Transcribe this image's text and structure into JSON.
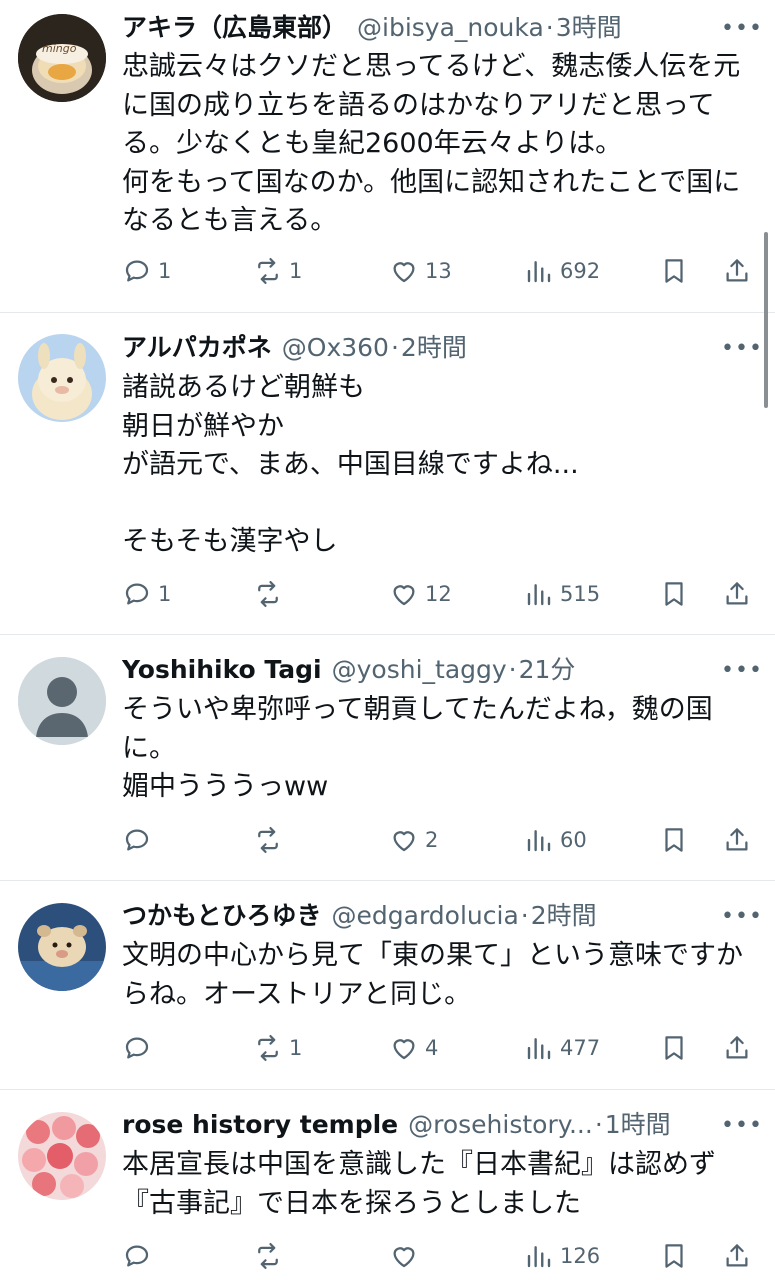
{
  "tweets": [
    {
      "name": "アキラ（広島東部）",
      "handle": "@ibisya_nouka",
      "time": "3時間",
      "text": "忠誠云々はクソだと思ってるけど、魏志倭人伝を元に国の成り立ちを語るのはかなりアリだと思ってる。少なくとも皇紀2600年云々よりは。\n何をもって国なのか。他国に認知されたことで国になるとも言える。",
      "avatar_text": "mingo",
      "replies": "1",
      "retweets": "1",
      "likes": "13",
      "views": "692"
    },
    {
      "name": "アルパカポネ",
      "handle": "@Ox360",
      "time": "2時間",
      "text": "諸説あるけど朝鮮も\n朝日が鮮やか\nが語元で、まあ、中国目線ですよね...\n\nそもそも漢字やし",
      "replies": "1",
      "retweets": "",
      "likes": "12",
      "views": "515"
    },
    {
      "name": "Yoshihiko Tagi",
      "handle": "@yoshi_taggy",
      "time": "21分",
      "text": "そういや卑弥呼って朝貢してたんだよね，魏の国に。\n媚中うううっww",
      "replies": "",
      "retweets": "",
      "likes": "2",
      "views": "60"
    },
    {
      "name": "つかもとひろゆき",
      "handle": "@edgardolucia",
      "time": "2時間",
      "text": "文明の中心から見て「東の果て」という意味ですからね。オーストリアと同じ。",
      "replies": "",
      "retweets": "1",
      "likes": "4",
      "views": "477"
    },
    {
      "name": "rose history temple",
      "handle": "@rosehistory...",
      "time": "1時間",
      "text": "本居宣長は中国を意識した『日本書紀』は認めず『古事記』で日本を探ろうとしました",
      "replies": "",
      "retweets": "",
      "likes": "",
      "views": "126"
    }
  ],
  "more_icon": "more-icon",
  "dot": "·",
  "colors": {
    "text": "#0f1419",
    "muted": "#536471",
    "divider": "#e6e9ec"
  }
}
